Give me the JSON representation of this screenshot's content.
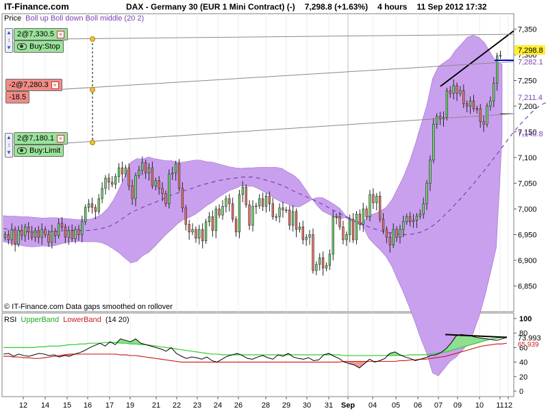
{
  "header": {
    "brand": "IT-Finance.com",
    "instrument": "DAX - Germany 30 (EUR 1 Mini Contract) (-)",
    "price_change": "7,298.8 (+1.63%)",
    "timeframe": "4 hours",
    "datetime": "11 Sep 2012 17:32"
  },
  "price_panel": {
    "legend_prefix": "Price",
    "legend_indicators": "Boll up Boll down Boll middle (20 2)",
    "footer_note": "© IT-Finance.com  Data gaps smoothed on rollover"
  },
  "rsi_panel": {
    "legend_prefix": "RSI",
    "legend_upper": "UpperBand",
    "legend_lower": "LowerBand",
    "legend_params": "(14 20)"
  },
  "orders": [
    {
      "label": "2@7,330.5",
      "action": "Buy:Stop",
      "side": "buy"
    },
    {
      "label": "-2@7,280.3",
      "pnl": "-18.5",
      "side": "sell"
    },
    {
      "label": "2@7,180.1",
      "action": "Buy:Limit",
      "side": "buy"
    }
  ],
  "price_badges": {
    "last": "7,298.8",
    "boll_up": "7,282.1",
    "boll_mid": "7,211.4",
    "boll_down": "7,140.8"
  },
  "rsi_badges": {
    "rsi": "73.993",
    "band": "65.939"
  },
  "colors": {
    "bollinger_fill": "#c9a0ee",
    "candle_up": "#6fd26f",
    "candle_down": "#e8736b",
    "rsi_upper": "#2fcc2f",
    "rsi_lower": "#d42222",
    "last_badge": "#ffee33"
  },
  "chart_data": [
    {
      "type": "candlestick",
      "title": "DAX - Germany 30 (EUR 1 Mini Contract) (-)",
      "ylim": [
        6800,
        7380
      ],
      "y_ticks": [
        "7,350",
        "7,300",
        "7,250",
        "7,200",
        "7,150",
        "7,100",
        "7,050",
        "7,000",
        "6,950",
        "6,900",
        "6,850"
      ],
      "x_ticks": [
        "12",
        "14",
        "15",
        "16",
        "17",
        "19",
        "21",
        "22",
        "23",
        "24",
        "26",
        "28",
        "29",
        "30",
        "31",
        "Sep",
        "04",
        "05",
        "06",
        "07",
        "09",
        "10",
        "11",
        "12"
      ],
      "close": [
        6950,
        6940,
        6960,
        6932,
        6958,
        6948,
        6965,
        6955,
        6945,
        6958,
        6945,
        6960,
        6950,
        6935,
        6957,
        6948,
        6972,
        6965,
        6945,
        6958,
        6942,
        6960,
        6950,
        6975,
        7003,
        7010,
        7003,
        6995,
        7020,
        7040,
        7060,
        7052,
        7048,
        7063,
        7080,
        7068,
        7080,
        7045,
        7020,
        7065,
        7075,
        7090,
        7070,
        7080,
        7045,
        7055,
        7040,
        7030,
        7010,
        7068,
        7070,
        7088,
        7040,
        7002,
        6970,
        6955,
        6960,
        6943,
        6960,
        6938,
        6975,
        6985,
        6958,
        7000,
        6988,
        7005,
        7020,
        7010,
        6980,
        6955,
        7028,
        7042,
        7008,
        6968,
        7005,
        7006,
        7020,
        7005,
        7025,
        7010,
        6985,
        6985,
        7002,
        6998,
        6998,
        6968,
        6995,
        6960,
        6965,
        6940,
        6945,
        6950,
        6880,
        6892,
        6905,
        6885,
        6890,
        6912,
        6985,
        6985,
        6965,
        6940,
        6950,
        6980,
        6940,
        6990,
        6970,
        7000,
        6985,
        7028,
        7012,
        7025,
        6980,
        6960,
        6945,
        6930,
        6960,
        6945,
        6960,
        6975,
        6985,
        6975,
        6978,
        6986,
        6990,
        7010,
        7050,
        7095,
        7165,
        7180,
        7175,
        7178,
        7230,
        7225,
        7240,
        7225,
        7230,
        7205,
        7200,
        7210,
        7195,
        7195,
        7170,
        7165,
        7200,
        7210,
        7245,
        7298,
        7298.8
      ],
      "bollinger_up": [
        6987,
        6986,
        6986,
        6985,
        6985,
        6984,
        6983,
        6982,
        6983,
        6983,
        6982,
        6981,
        6980,
        6979,
        6980,
        6980,
        6984,
        6990,
        7001,
        7018,
        7040,
        7066,
        7091,
        7098,
        7097,
        7101,
        7098,
        7096,
        7094,
        7094,
        7091,
        7091,
        7093,
        7095,
        7095,
        7092,
        7091,
        7088,
        7085,
        7082,
        7080,
        7079,
        7080,
        7080,
        7081,
        7081,
        7081,
        7081,
        7079,
        7072,
        7066,
        7056,
        7040,
        7023,
        7008,
        6996,
        6990,
        6985,
        6981,
        6983,
        6977,
        6976,
        6973,
        6987,
        6991,
        6996,
        7003,
        7018,
        7040,
        7063,
        7091,
        7125,
        7163,
        7201,
        7253,
        7277,
        7285,
        7293,
        7309,
        7321,
        7334,
        7338,
        7334,
        7323,
        7304,
        7285,
        7282.1
      ],
      "bollinger_mid": [
        6962,
        6960,
        6958,
        6957,
        6956,
        6955,
        6955,
        6955,
        6955,
        6956,
        6957,
        6958,
        6958,
        6958,
        6958,
        6958,
        6960,
        6962,
        6965,
        6970,
        6977,
        6985,
        6993,
        6998,
        7003,
        7008,
        7012,
        7017,
        7022,
        7027,
        7031,
        7035,
        7038,
        7042,
        7046,
        7049,
        7052,
        7055,
        7057,
        7059,
        7060,
        7062,
        7062,
        7062,
        7060,
        7057,
        7054,
        7050,
        7046,
        7041,
        7035,
        7030,
        7025,
        7020,
        7015,
        7009,
        7003,
        6997,
        6991,
        6985,
        6979,
        6974,
        6970,
        6965,
        6961,
        6958,
        6955,
        6953,
        6951,
        6950,
        6950,
        6952,
        6955,
        6960,
        6967,
        6976,
        6987,
        6998,
        7010,
        7022,
        7035,
        7048,
        7062,
        7076,
        7090,
        7105,
        7120,
        7135,
        7150,
        7163,
        7175,
        7187,
        7197,
        7204,
        7209,
        7211.4
      ],
      "bollinger_down": [
        6936,
        6934,
        6930,
        6929,
        6927,
        6926,
        6927,
        6928,
        6927,
        6929,
        6932,
        6935,
        6936,
        6937,
        6936,
        6936,
        6936,
        6934,
        6929,
        6922,
        6914,
        6904,
        6895,
        6898,
        6909,
        6915,
        6926,
        6938,
        6950,
        6960,
        6971,
        6979,
        6983,
        6989,
        6997,
        7006,
        7013,
        7022,
        7029,
        7036,
        7040,
        7045,
        7044,
        7044,
        7039,
        7033,
        7027,
        7019,
        7013,
        7010,
        7004,
        7004,
        7010,
        7017,
        7022,
        7022,
        7016,
        7009,
        7001,
        6987,
        6981,
        6972,
        6967,
        6943,
        6931,
        6920,
        6907,
        6888,
        6862,
        6837,
        6809,
        6779,
        6747,
        6719,
        6681,
        6675,
        6689,
        6703,
        6711,
        6723,
        6736,
        6758,
        6790,
        6829,
        6876,
        6925,
        7140.8
      ]
    },
    {
      "type": "line",
      "title": "RSI (14 20)",
      "ylim": [
        0,
        100
      ],
      "y_ticks": [
        "100",
        "80",
        "60",
        "40",
        "20",
        "0"
      ],
      "series": [
        {
          "name": "RSI",
          "values": [
            51,
            52,
            48,
            51,
            49,
            48,
            50,
            52,
            51,
            49,
            50,
            47,
            49,
            48,
            51,
            53,
            56,
            60,
            63,
            66,
            62,
            68,
            64,
            72,
            70,
            68,
            72,
            66,
            64,
            62,
            60,
            58,
            55,
            60,
            52,
            48,
            45,
            47,
            46,
            44,
            47,
            42,
            40,
            44,
            48,
            50,
            52,
            49,
            45,
            44,
            47,
            49,
            46,
            44,
            50,
            48,
            52,
            47,
            45,
            44,
            46,
            42,
            43,
            50,
            52,
            48,
            45,
            40,
            38,
            36,
            32,
            38,
            44,
            40,
            42,
            45,
            52,
            54,
            50,
            47,
            45,
            42,
            44,
            46,
            49,
            50,
            53,
            58,
            66,
            76,
            78,
            77,
            76,
            74,
            73,
            72,
            71,
            70,
            72,
            73.993
          ]
        },
        {
          "name": "UpperBand",
          "values": [
            60,
            60,
            60,
            60,
            60,
            60,
            60,
            61,
            61,
            62,
            62,
            62,
            63,
            64,
            64,
            65,
            65,
            66,
            66,
            66,
            67,
            67,
            67,
            66,
            66,
            65,
            65,
            64,
            64,
            63,
            62,
            61,
            60,
            59,
            58,
            57,
            56,
            55,
            54,
            53,
            52,
            51,
            51,
            50,
            50,
            50,
            50,
            50,
            50,
            50,
            50,
            50,
            50,
            50,
            50,
            50,
            50,
            50,
            50,
            50,
            50,
            50,
            50,
            50,
            50,
            50,
            50,
            49,
            49,
            49,
            49,
            49,
            49,
            49,
            49,
            49,
            49,
            49,
            49,
            49,
            50,
            50,
            50,
            50,
            51,
            52,
            53,
            54,
            56,
            58,
            60,
            62,
            64,
            66,
            68,
            70,
            72,
            73,
            74,
            75
          ]
        },
        {
          "name": "LowerBand",
          "values": [
            48,
            48,
            47,
            47,
            46,
            46,
            45,
            45,
            46,
            47,
            48,
            49,
            50,
            51,
            51,
            51,
            51,
            51,
            51,
            51,
            51,
            51,
            51,
            50,
            50,
            49,
            49,
            48,
            47,
            46,
            45,
            44,
            43,
            42,
            41,
            40,
            40,
            40,
            40,
            40,
            40,
            40,
            40,
            40,
            40,
            40,
            40,
            40,
            40,
            40,
            40,
            40,
            40,
            40,
            40,
            40,
            40,
            40,
            40,
            40,
            40,
            40,
            40,
            40,
            40,
            40,
            40,
            41,
            41,
            41,
            41,
            41,
            41,
            41,
            41,
            41,
            41,
            41,
            42,
            42,
            43,
            43,
            44,
            44,
            45,
            46,
            47,
            48,
            50,
            52,
            54,
            56,
            58,
            60,
            62,
            63,
            64,
            65,
            65,
            66
          ]
        }
      ]
    }
  ]
}
